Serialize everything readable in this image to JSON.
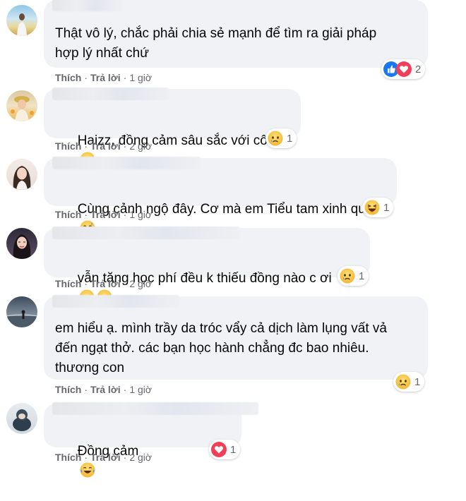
{
  "comments": [
    {
      "text": "Thật vô lý, chắc phải chia sẻ mạnh để tìm ra giải pháp\nhợp lý nhất chứ",
      "like": "Thích",
      "reply": "Trả lời",
      "time": "1 giờ",
      "reactions": [
        "like-icon",
        "love-icon"
      ],
      "reaction_count": "2"
    },
    {
      "text": "Haizz, đồng cảm sâu sắc với cô Lê",
      "inline_emoji": "disappointed-face-icon",
      "like": "Thích",
      "reply": "Trả lời",
      "time": "2 giờ",
      "reactions": [
        "sad-icon"
      ],
      "reaction_count": "1"
    },
    {
      "text": "Cùng cảnh ngộ đây. Cơ mà em Tiểu tam xinh quá",
      "inline_emoji": "grinning-sweat-face-icon",
      "like": "Thích",
      "reply": "Trả lời",
      "time": "1 giờ",
      "reactions": [
        "haha-icon"
      ],
      "reaction_count": "1"
    },
    {
      "text": "vẫn tăng học phí đều k thiếu đồng nào c ơi",
      "inline_emoji": "crying-face-icon x2",
      "like": "Thích",
      "reply": "Trả lời",
      "time": "2 giờ",
      "reactions": [
        "sad-icon"
      ],
      "reaction_count": "1"
    },
    {
      "text": "em hiểu ạ. mình trầy da tróc vẩy cả dịch làm lụng vất vả\nđến ngạt thở. các bạn học hành chẳng đc bao nhiêu.\nthương con",
      "like": "Thích",
      "reply": "Trả lời",
      "time": "1 giờ",
      "reactions": [
        "sad-icon"
      ],
      "reaction_count": "1"
    },
    {
      "text": "Đồng cảm",
      "inline_emoji": "tears-of-joy-face-icon",
      "like": "Thích",
      "reply": "Trả lời",
      "time": "2 giờ",
      "reactions": [
        "love-icon"
      ],
      "reaction_count": "1"
    }
  ],
  "colors": {
    "bubble": "#f0f2f5",
    "meta_text": "#65676b",
    "like_blue": "#1877f2",
    "love_red": "#f33e58",
    "emoji_yellow": "#f7c948"
  }
}
